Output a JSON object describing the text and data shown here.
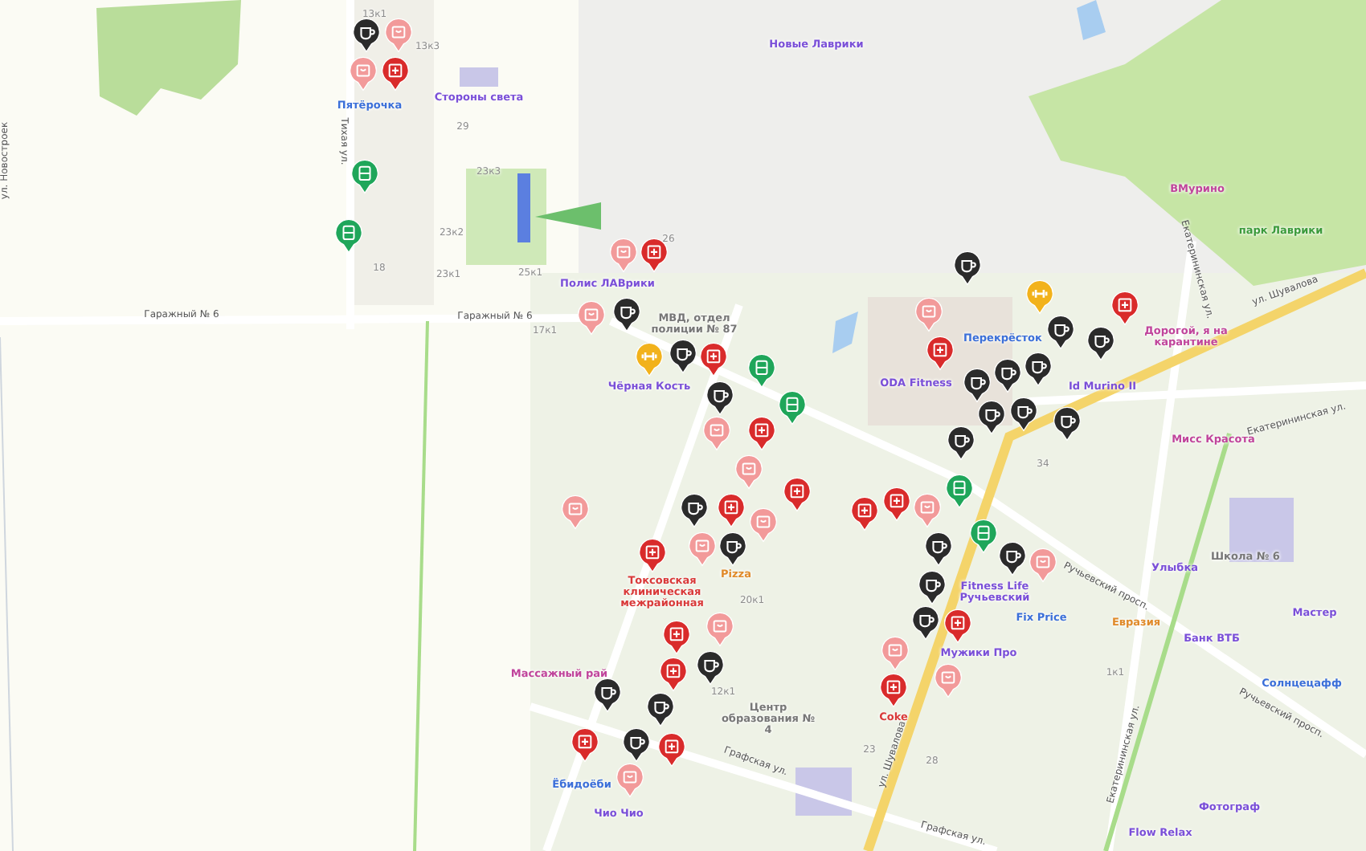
{
  "map": {
    "labels": [
      {
        "kind": "street",
        "text": "ул. Новостроек"
      },
      {
        "kind": "street",
        "text": "Тихая ул."
      },
      {
        "kind": "street",
        "text": "Гаражный № 6"
      },
      {
        "kind": "street",
        "text": "Гаражный № 6"
      },
      {
        "kind": "street",
        "text": "ул. Шувалова"
      },
      {
        "kind": "street",
        "text": "ул. Шувалова"
      },
      {
        "kind": "street",
        "text": "Екатерининская ул."
      },
      {
        "kind": "street",
        "text": "Екатерининская ул."
      },
      {
        "kind": "street",
        "text": "Екатерининская ул."
      },
      {
        "kind": "street",
        "text": "Ручьевский просп."
      },
      {
        "kind": "street",
        "text": "Ручьевский просп."
      },
      {
        "kind": "street",
        "text": "Графская ул."
      },
      {
        "kind": "street",
        "text": "Графская ул."
      },
      {
        "kind": "place",
        "text": "Пятёрочка",
        "color": "#3b6fd9"
      },
      {
        "kind": "place",
        "text": "Стороны света",
        "color": "#7a4fd8"
      },
      {
        "kind": "place",
        "text": "Новые Лаврики",
        "color": "#7a4fd8"
      },
      {
        "kind": "place",
        "text": "ВМурино",
        "color": "#c0449b"
      },
      {
        "kind": "place",
        "text": "парк Лаврики",
        "color": "#3b9a3b"
      },
      {
        "kind": "place",
        "text": "Полис ЛАВрики",
        "color": "#7a4fd8"
      },
      {
        "kind": "place",
        "text": "МВД, отдел полиции № 87",
        "color": "#777777"
      },
      {
        "kind": "place",
        "text": "Чёрная Кость",
        "color": "#7a4fd8"
      },
      {
        "kind": "place",
        "text": "Перекрёсток",
        "color": "#3b6fd9"
      },
      {
        "kind": "place",
        "text": "ODA Fitness",
        "color": "#7a4fd8"
      },
      {
        "kind": "place",
        "text": "Id Murino II",
        "color": "#7a4fd8"
      },
      {
        "kind": "place",
        "text": "Дорогой, я на карантине",
        "color": "#c0449b"
      },
      {
        "kind": "place",
        "text": "Мисс Красота",
        "color": "#c0449b"
      },
      {
        "kind": "place",
        "text": "Токсовская клиническая межрайонная",
        "color": "#d93a3a"
      },
      {
        "kind": "place",
        "text": "Массажный рай",
        "color": "#c0449b"
      },
      {
        "kind": "place",
        "text": "Pizza",
        "color": "#e08a2a"
      },
      {
        "kind": "place",
        "text": "Coke",
        "color": "#d93a3a"
      },
      {
        "kind": "place",
        "text": "Центр образования № 4",
        "color": "#777777"
      },
      {
        "kind": "place",
        "text": "Fitness Life Ручьевский",
        "color": "#7a4fd8"
      },
      {
        "kind": "place",
        "text": "Fix Price",
        "color": "#3b6fd9"
      },
      {
        "kind": "place",
        "text": "Мужики Про",
        "color": "#7a4fd8"
      },
      {
        "kind": "place",
        "text": "Евразия",
        "color": "#e08a2a"
      },
      {
        "kind": "place",
        "text": "Улыбка",
        "color": "#7a4fd8"
      },
      {
        "kind": "place",
        "text": "Школа № 6",
        "color": "#777777"
      },
      {
        "kind": "place",
        "text": "Мастер",
        "color": "#7a4fd8"
      },
      {
        "kind": "place",
        "text": "Банк ВТБ",
        "color": "#7a4fd8"
      },
      {
        "kind": "place",
        "text": "Солнцецафф",
        "color": "#3b6fd9"
      },
      {
        "kind": "place",
        "text": "Фотограф",
        "color": "#7a4fd8"
      },
      {
        "kind": "place",
        "text": "Flow Relax",
        "color": "#7a4fd8"
      },
      {
        "kind": "place",
        "text": "Ёбидоёби",
        "color": "#3b6fd9"
      },
      {
        "kind": "place",
        "text": "Чио Чио",
        "color": "#7a4fd8"
      },
      {
        "kind": "building",
        "text": "13к1"
      },
      {
        "kind": "building",
        "text": "13к3"
      },
      {
        "kind": "building",
        "text": "29"
      },
      {
        "kind": "building",
        "text": "23к3"
      },
      {
        "kind": "building",
        "text": "23к2"
      },
      {
        "kind": "building",
        "text": "23к1"
      },
      {
        "kind": "building",
        "text": "25к1"
      },
      {
        "kind": "building",
        "text": "18"
      },
      {
        "kind": "building",
        "text": "26"
      },
      {
        "kind": "building",
        "text": "17к1"
      },
      {
        "kind": "building",
        "text": "20к1"
      },
      {
        "kind": "building",
        "text": "12к1"
      },
      {
        "kind": "building",
        "text": "23"
      },
      {
        "kind": "building",
        "text": "28"
      },
      {
        "kind": "building",
        "text": "34"
      },
      {
        "kind": "building",
        "text": "1к1"
      }
    ],
    "pins": [
      {
        "kind": "cafe"
      },
      {
        "kind": "shop"
      },
      {
        "kind": "pharmacy"
      },
      {
        "kind": "bus"
      },
      {
        "kind": "bus"
      },
      {
        "kind": "shop"
      },
      {
        "kind": "pharmacy"
      },
      {
        "kind": "shop"
      },
      {
        "kind": "cafe"
      },
      {
        "kind": "fitness"
      },
      {
        "kind": "cafe"
      },
      {
        "kind": "pharmacy"
      },
      {
        "kind": "cafe"
      },
      {
        "kind": "bus"
      },
      {
        "kind": "bus"
      },
      {
        "kind": "shop"
      },
      {
        "kind": "pharmacy"
      },
      {
        "kind": "shop"
      },
      {
        "kind": "pharmacy"
      },
      {
        "kind": "pharmacy"
      },
      {
        "kind": "shop"
      },
      {
        "kind": "cafe"
      },
      {
        "kind": "shop"
      },
      {
        "kind": "pharmacy"
      },
      {
        "kind": "shop"
      },
      {
        "kind": "pharmacy"
      },
      {
        "kind": "pharmacy"
      },
      {
        "kind": "cafe"
      },
      {
        "kind": "cafe"
      },
      {
        "kind": "cafe"
      },
      {
        "kind": "pharmacy"
      },
      {
        "kind": "pharmacy"
      },
      {
        "kind": "shop"
      },
      {
        "kind": "shop"
      },
      {
        "kind": "pharmacy"
      },
      {
        "kind": "cafe"
      },
      {
        "kind": "fitness"
      },
      {
        "kind": "cafe"
      },
      {
        "kind": "cafe"
      },
      {
        "kind": "pharmacy"
      },
      {
        "kind": "cafe"
      },
      {
        "kind": "cafe"
      },
      {
        "kind": "cafe"
      },
      {
        "kind": "pharmacy"
      },
      {
        "kind": "shop"
      },
      {
        "kind": "bus"
      },
      {
        "kind": "bus"
      },
      {
        "kind": "cafe"
      },
      {
        "kind": "cafe"
      },
      {
        "kind": "shop"
      },
      {
        "kind": "cafe"
      },
      {
        "kind": "cafe"
      },
      {
        "kind": "shop"
      },
      {
        "kind": "pharmacy"
      },
      {
        "kind": "cafe"
      },
      {
        "kind": "cafe"
      },
      {
        "kind": "shop"
      },
      {
        "kind": "cafe"
      },
      {
        "kind": "cafe"
      },
      {
        "kind": "pharmacy"
      },
      {
        "kind": "shop"
      },
      {
        "kind": "cafe"
      },
      {
        "kind": "shop"
      },
      {
        "kind": "pharmacy"
      },
      {
        "kind": "cafe"
      }
    ]
  }
}
